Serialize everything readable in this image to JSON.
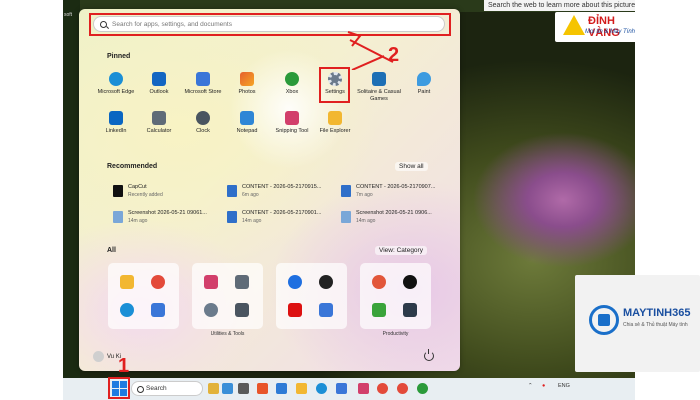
{
  "tooltip": "Search the web to learn more about this picture",
  "desktop_edge_text": "soft",
  "logos": {
    "dinh_vang": {
      "name": "ĐỈNH VÀNG",
      "tagline": "Mọi tin & Máy Tính"
    },
    "maytinh365": {
      "name": "MAYTINH365",
      "tagline": "Chia sẻ & Thủ thuật Máy tính"
    }
  },
  "start_menu": {
    "search_placeholder": "Search for apps, settings, and documents",
    "pinned_label": "Pinned",
    "pinned_apps": [
      {
        "label": "Microsoft Edge",
        "icon": "edge-icon",
        "color": "#1b8fd6"
      },
      {
        "label": "Outlook",
        "icon": "outlook-icon",
        "color": "#1366c2"
      },
      {
        "label": "Microsoft Store",
        "icon": "store-icon",
        "color": "#3a76d8"
      },
      {
        "label": "Photos",
        "icon": "photos-icon",
        "color": "#e6602f"
      },
      {
        "label": "Xbox",
        "icon": "xbox-icon",
        "color": "#2b9a3a"
      },
      {
        "label": "Settings",
        "icon": "gear-icon",
        "color": "#6b7b8c"
      },
      {
        "label": "Solitaire & Casual Games",
        "icon": "solitaire-icon",
        "color": "#1d6fb5"
      },
      {
        "label": "Paint",
        "icon": "paint-icon",
        "color": "#3d9be0"
      },
      {
        "label": "LinkedIn",
        "icon": "linkedin-icon",
        "color": "#0a66c2"
      },
      {
        "label": "Calculator",
        "icon": "calculator-icon",
        "color": "#5f6b77"
      },
      {
        "label": "Clock",
        "icon": "clock-icon",
        "color": "#4a5560"
      },
      {
        "label": "Notepad",
        "icon": "notepad-icon",
        "color": "#2f86d6"
      },
      {
        "label": "Snipping Tool",
        "icon": "snipping-icon",
        "color": "#d23f6b"
      },
      {
        "label": "File Explorer",
        "icon": "folder-icon",
        "color": "#f2b731"
      }
    ],
    "recommended_label": "Recommended",
    "show_all": "Show all",
    "recommended": [
      {
        "title": "CapCut",
        "sub": "Recently added",
        "icon": "capcut-icon"
      },
      {
        "title": "CONTENT - 2026-05-2170915...",
        "sub": "6m ago",
        "icon": "document-icon"
      },
      {
        "title": "CONTENT - 2026-05-2170907...",
        "sub": "7m ago",
        "icon": "document-icon"
      },
      {
        "title": "Screenshot 2026-05-21 09061...",
        "sub": "14m ago",
        "icon": "image-file-icon"
      },
      {
        "title": "CONTENT - 2026-05-2170901...",
        "sub": "14m ago",
        "icon": "document-icon"
      },
      {
        "title": "Screenshot 2026-05-21 0906...",
        "sub": "14m ago",
        "icon": "image-file-icon"
      }
    ],
    "all_label": "All",
    "view_label": "View: Category",
    "folder_labels": [
      "",
      "Utilities & Tools",
      "",
      "Productivity"
    ],
    "user_name": "Vu Ki"
  },
  "annotations": {
    "step1": "1",
    "step2": "2"
  },
  "taskbar": {
    "search_label": "Search",
    "tray_lang": "ENG",
    "icon_colors": [
      "#e2b23a",
      "#3a8fd8",
      "#e04040",
      "#e8552a",
      "#1b8fd6",
      "#2e7bd6",
      "#f0a020",
      "#5a5a5a",
      "#1d6fb5",
      "#6b7b8c",
      "#d23f6b",
      "#2b9a3a",
      "#4a4a4a"
    ]
  }
}
